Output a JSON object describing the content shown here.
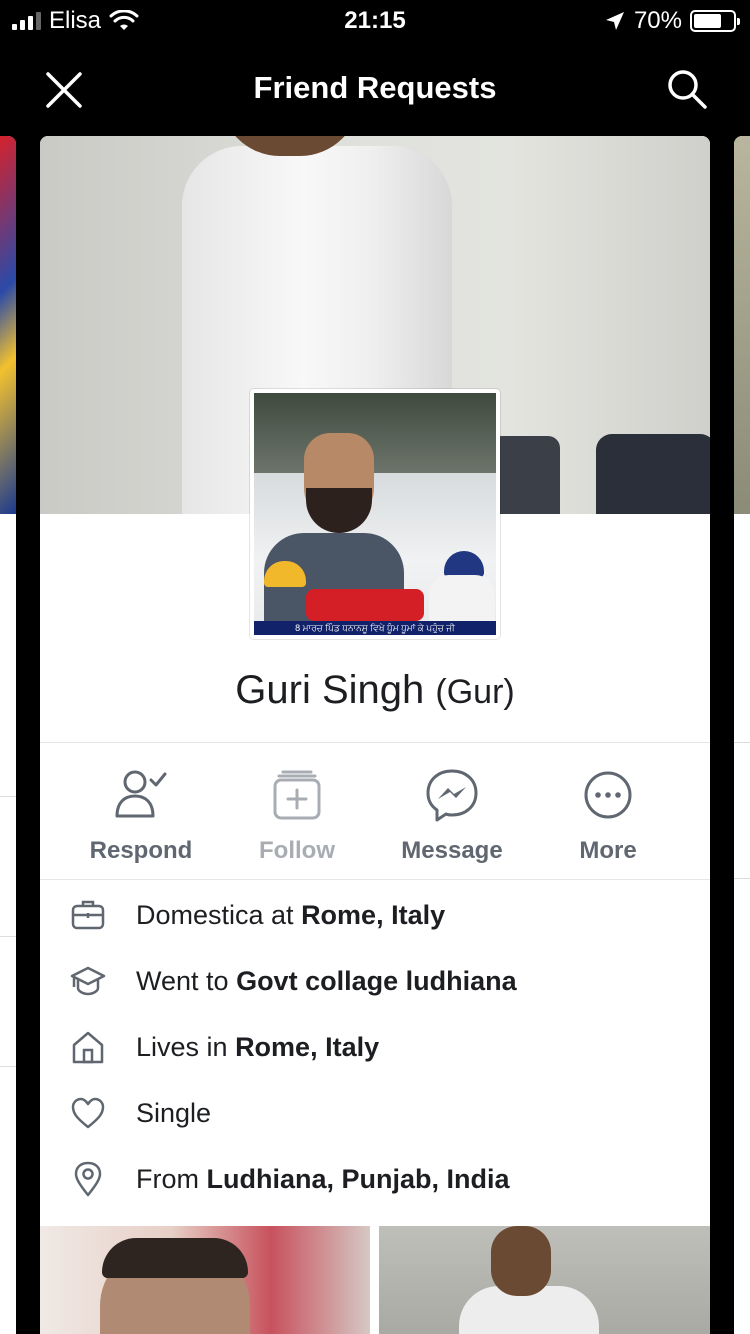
{
  "status_bar": {
    "carrier": "Elisa",
    "time": "21:15",
    "battery_percent": "70%",
    "battery_level": 0.7
  },
  "nav": {
    "title": "Friend Requests",
    "close_icon": "close-icon",
    "search_icon": "search-icon"
  },
  "profile": {
    "name": "Guri Singh",
    "alternate_name": "(Gur)",
    "photo_banner_text": "8 ਮਾਰਚ ਪਿੰਡ ਧਨਾਨਸੂ ਵਿਖੇ ਧੂੰਮ ਧੂਮਾਂ ਕੇ ਪਹੁੰਚ ਜੀ"
  },
  "actions": [
    {
      "label": "Respond",
      "icon": "respond-person-check-icon",
      "enabled": true
    },
    {
      "label": "Follow",
      "icon": "follow-plus-icon",
      "enabled": false
    },
    {
      "label": "Message",
      "icon": "messenger-icon",
      "enabled": true
    },
    {
      "label": "More",
      "icon": "more-dots-icon",
      "enabled": true
    }
  ],
  "info": {
    "work": {
      "prefix": "Domestica at ",
      "bold": "Rome, Italy",
      "icon": "briefcase-icon"
    },
    "education": {
      "prefix": "Went to ",
      "bold": "Govt collage ludhiana",
      "icon": "graduation-cap-icon"
    },
    "lives": {
      "prefix": "Lives in ",
      "bold": "Rome, Italy",
      "icon": "home-icon"
    },
    "relationship": {
      "prefix": "Single",
      "bold": "",
      "icon": "heart-icon"
    },
    "from": {
      "prefix": "From ",
      "bold": "Ludhiana, Punjab, India",
      "icon": "location-pin-icon"
    }
  },
  "colors": {
    "background": "#000000",
    "card": "#ffffff",
    "text_primary": "#1c1e21",
    "text_secondary": "#606770",
    "text_disabled": "#a8acb3"
  }
}
